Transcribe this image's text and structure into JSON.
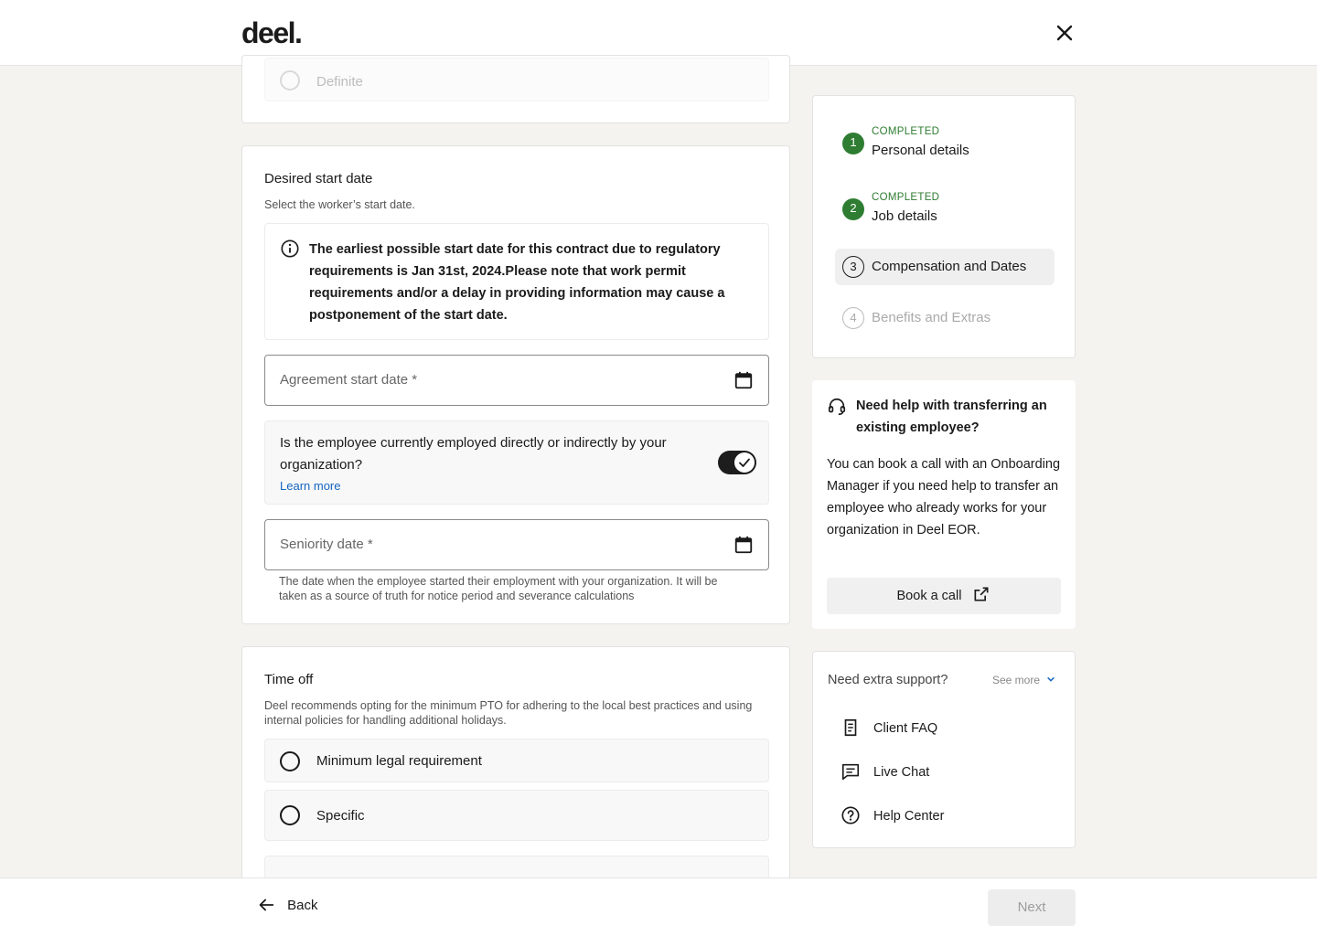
{
  "header": {
    "logo": "deel."
  },
  "contract_type": {
    "option_definite": "Definite"
  },
  "start_date": {
    "title": "Desired start date",
    "subtitle": "Select the worker’s start date.",
    "info": "The earliest possible start date for this contract due to regulatory requirements is Jan 31st, 2024.Please note that work permit requirements and/or a delay in providing information may cause a postponement of the start date.",
    "agreement_placeholder": "Agreement start date *",
    "employed_question": "Is the employee currently employed directly or indirectly by your organization?",
    "learn_more": "Learn more",
    "employed_toggle_on": true,
    "seniority_placeholder": "Seniority date *",
    "seniority_help": "The date when the employee started their employment with your organization. It will be taken as a source of truth for notice period and severance calculations"
  },
  "time_off": {
    "title": "Time off",
    "subtitle": "Deel recommends opting for the minimum PTO for adhering to the local best practices and using internal policies for handling additional holidays.",
    "option_minimum": "Minimum legal requirement",
    "option_specific": "Specific"
  },
  "steps": [
    {
      "number": "1",
      "status": "COMPLETED",
      "label": "Personal details"
    },
    {
      "number": "2",
      "status": "COMPLETED",
      "label": "Job details"
    },
    {
      "number": "3",
      "status": "",
      "label": "Compensation and Dates"
    },
    {
      "number": "4",
      "status": "",
      "label": "Benefits and Extras"
    }
  ],
  "help": {
    "title": "Need help with transferring an existing employee?",
    "body": "You can book a call with an Onboarding Manager if you need help to transfer an employee who already works for your organization in Deel EOR.",
    "book_button": "Book a call"
  },
  "support": {
    "title": "Need extra support?",
    "see_more": "See more",
    "items": [
      "Client FAQ",
      "Live Chat",
      "Help Center"
    ]
  },
  "footer": {
    "back": "Back",
    "next": "Next"
  },
  "colors": {
    "completed": "#2e7d32",
    "link": "#1565c0",
    "background": "#f4f3f0"
  }
}
